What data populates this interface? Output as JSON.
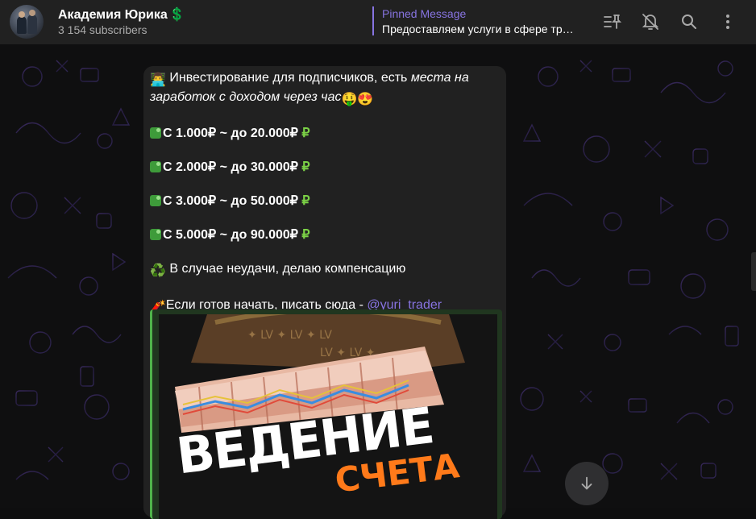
{
  "header": {
    "channel_name": "Академия Юрика",
    "channel_emoji": "💲",
    "subscribers": "3 154 subscribers",
    "pinned_label": "Pinned Message",
    "pinned_text": "Предоставляем услуги в сфере тр…",
    "icons": [
      "pinned-list-icon",
      "bell-muted-icon",
      "search-icon",
      "more-vertical-icon"
    ]
  },
  "message": {
    "intro_emoji": "👨‍💻",
    "intro_text": " Инвестирование для подписчиков, есть ",
    "intro_italic": "места на заработок с доходом через час",
    "intro_emoji_end": "🤑😍",
    "offers": [
      "С 1.000₽ ~ до 20.000₽",
      "С 2.000₽ ~ до 30.000₽",
      "С 3.000₽ ~ до 50.000₽",
      "С 5.000₽ ~ до 90.000₽"
    ],
    "offer_suffix": "₽",
    "compensation_emoji": "♻️",
    "compensation_text": " В случае неудачи, делаю компенсацию",
    "contact_emoji": "🧨",
    "contact_text": "Если готов начать, писать сюда - ",
    "contact_link": "@yuri_trader"
  },
  "media": {
    "title_line1": "ВЕДЕНИЕ",
    "title_line2": "СЧЕТА"
  },
  "colors": {
    "accent": "#8774e1",
    "header_bg": "#212121",
    "bubble_bg": "#212121",
    "ruble_green": "#7bd146",
    "media_border": "#4fb34a"
  }
}
